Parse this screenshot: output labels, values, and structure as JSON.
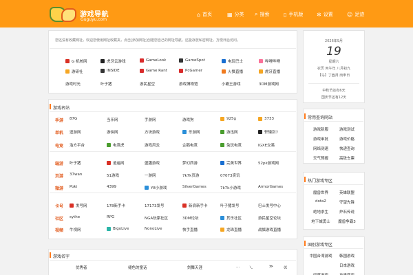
{
  "header": {
    "logo_text": "游戏导航",
    "logo_sub": "Guguyu.com",
    "nav": [
      {
        "icon": "home-icon",
        "glyph": "⌂",
        "label": "首页"
      },
      {
        "icon": "grid-icon",
        "glyph": "▦",
        "label": "分类"
      },
      {
        "icon": "search-icon",
        "glyph": "⌕",
        "label": "搜索"
      },
      {
        "icon": "phone-icon",
        "glyph": "▯",
        "label": "手机版"
      },
      {
        "icon": "gear-icon",
        "glyph": "✲",
        "label": "设置"
      },
      {
        "icon": "user-icon",
        "glyph": "☺",
        "label": "足迹"
      }
    ]
  },
  "notice": "您还没有收藏网址，欢迎您使用网址收藏夹，点击[添加网址]创建您自己的网址导航。还能存放私密网址，方便日后访问。",
  "favorites": [
    [
      {
        "label": "G 机核网",
        "color": "#d93025"
      },
      {
        "label": "虎牙云游戏",
        "color": "#222"
      },
      {
        "label": "GameLook",
        "color": "#d92b2b"
      },
      {
        "label": "GameSpot",
        "color": "#333"
      },
      {
        "label": "电玩巴士",
        "color": "#1a6fd1"
      },
      {
        "label": "哔哩哔哩",
        "color": "#fb7299"
      }
    ],
    [
      {
        "label": "游研社",
        "color": "#f5a623"
      },
      {
        "label": "INSIDE",
        "color": "#333"
      },
      {
        "label": "Game Rant",
        "color": "#d92b2b"
      },
      {
        "label": "PcGamer",
        "color": "#d92b2b"
      },
      {
        "label": "火猫直播",
        "color": "#f07a1e"
      },
      {
        "label": "虎牙直播",
        "color": "#f5a623"
      }
    ],
    [
      {
        "label": "游戏时光",
        "color": ""
      },
      {
        "label": "叶子猪",
        "color": ""
      },
      {
        "label": "游民星空",
        "color": ""
      },
      {
        "label": "游戏博物馆",
        "color": ""
      },
      {
        "label": "小霸王游戏",
        "color": ""
      },
      {
        "label": "3DM游戏网",
        "color": ""
      }
    ]
  ],
  "calendar": {
    "month": "2026年9月",
    "day": "19",
    "weekday": "星期六",
    "lunar": "农历 丙午年 八月初九",
    "ganzhi": "【马】丁酉月 丙申日",
    "festival1": "中秋节还有6天",
    "festival2": "国庆节还有12天"
  },
  "sites": {
    "title": "游戏名站",
    "rows": [
      {
        "label": "手游",
        "items": [
          {
            "t": "87G",
            "c": ""
          },
          {
            "t": "当乐网",
            "c": ""
          },
          {
            "t": "手游网",
            "c": ""
          },
          {
            "t": "游戏狗",
            "c": ""
          },
          {
            "t": "925g",
            "c": "#f5a623"
          },
          {
            "t": "3733",
            "c": "#f5a623"
          }
        ]
      },
      {
        "label": "单机",
        "items": [
          {
            "t": "逗游网",
            "c": ""
          },
          {
            "t": "游侠网",
            "c": ""
          },
          {
            "t": "方块游戏",
            "c": ""
          },
          {
            "t": "乐游网",
            "c": "#2b8fd9"
          },
          {
            "t": "游迅网",
            "c": "#4a9d2e"
          },
          {
            "t": "轩辕剑7",
            "c": "#222"
          }
        ]
      },
      {
        "label": "电竞",
        "items": [
          {
            "t": "浩方平台",
            "c": ""
          },
          {
            "t": "电竞虎",
            "c": "#4a9d2e"
          },
          {
            "t": "游戏风云",
            "c": ""
          },
          {
            "t": "企鹅电竞",
            "c": ""
          },
          {
            "t": "兔玩电竞",
            "c": "#4a9d2e"
          },
          {
            "t": "IGXE交易",
            "c": ""
          }
        ]
      },
      {
        "label": "端游",
        "items": [
          {
            "t": "叶子猪",
            "c": ""
          },
          {
            "t": "逍遥网",
            "c": "#d93025"
          },
          {
            "t": "盛趣游戏",
            "c": ""
          },
          {
            "t": "梦幻西游",
            "c": ""
          },
          {
            "t": "完美世界",
            "c": "#1a6fd1"
          },
          {
            "t": "52pk游戏网",
            "c": ""
          }
        ]
      },
      {
        "label": "页游",
        "items": [
          {
            "t": "37wan",
            "c": ""
          },
          {
            "t": "51游戏",
            "c": ""
          },
          {
            "t": "一游网",
            "c": ""
          },
          {
            "t": "7k7k页游",
            "c": ""
          },
          {
            "t": "07073资讯",
            "c": ""
          }
        ]
      },
      {
        "label": "微游",
        "items": [
          {
            "t": "Poki",
            "c": ""
          },
          {
            "t": "4399",
            "c": ""
          },
          {
            "t": "Y8小游戏",
            "c": "#2b8fd9"
          },
          {
            "t": "SilverGames",
            "c": ""
          },
          {
            "t": "7k7k小游戏",
            "c": ""
          },
          {
            "t": "ArmorGames",
            "c": ""
          }
        ]
      },
      {
        "label": "卡号",
        "items": [
          {
            "t": "发号网",
            "c": "#d93025"
          },
          {
            "t": "178新手卡",
            "c": ""
          },
          {
            "t": "17173发号",
            "c": ""
          },
          {
            "t": "新浪新手卡",
            "c": "#d93025"
          },
          {
            "t": "叶子猪发号",
            "c": ""
          },
          {
            "t": "巴士发号中心",
            "c": ""
          }
        ]
      },
      {
        "label": "社区",
        "items": [
          {
            "t": "sythe",
            "c": ""
          },
          {
            "t": "RPG",
            "c": ""
          },
          {
            "t": "NGA玩家社区",
            "c": ""
          },
          {
            "t": "3DM论坛",
            "c": ""
          },
          {
            "t": "其乐社区",
            "c": "#2b8fd9"
          },
          {
            "t": "游民星空论坛",
            "c": ""
          }
        ]
      },
      {
        "label": "视频",
        "items": [
          {
            "t": "牛视网",
            "c": ""
          },
          {
            "t": "BigoLive",
            "c": "#2bb5a8"
          },
          {
            "t": "NonoLive",
            "c": ""
          },
          {
            "t": "快手直播",
            "c": ""
          },
          {
            "t": "龙珠直播",
            "c": "#f5a623"
          },
          {
            "t": "战旗游戏直播",
            "c": ""
          }
        ]
      }
    ]
  },
  "common": {
    "title": "常用查询网站",
    "items": [
      "游戏新服",
      "游戏测试",
      "游戏审批",
      "游戏价格",
      "网络测速",
      "快递查询",
      "天气预报",
      "高铁车票"
    ]
  },
  "hot": {
    "title": "热门游戏专区",
    "items": [
      "魔兽世界",
      "英雄联盟",
      "dota2",
      "守望先锋",
      "绝地求生",
      "炉石传说",
      "地下城勇士",
      "魔兽争霸3"
    ]
  },
  "intl": {
    "title": "国别游戏专区",
    "items": [
      "中国台湾游戏",
      "韩国游戏",
      "",
      "日本游戏",
      "印度游戏",
      "马来西亚"
    ]
  },
  "bottom": {
    "title": "游戏名字",
    "items": [
      "优秀者",
      "褪色的童话",
      "剑舞天涯",
      "…",
      "乀",
      "≫",
      "巛"
    ]
  }
}
